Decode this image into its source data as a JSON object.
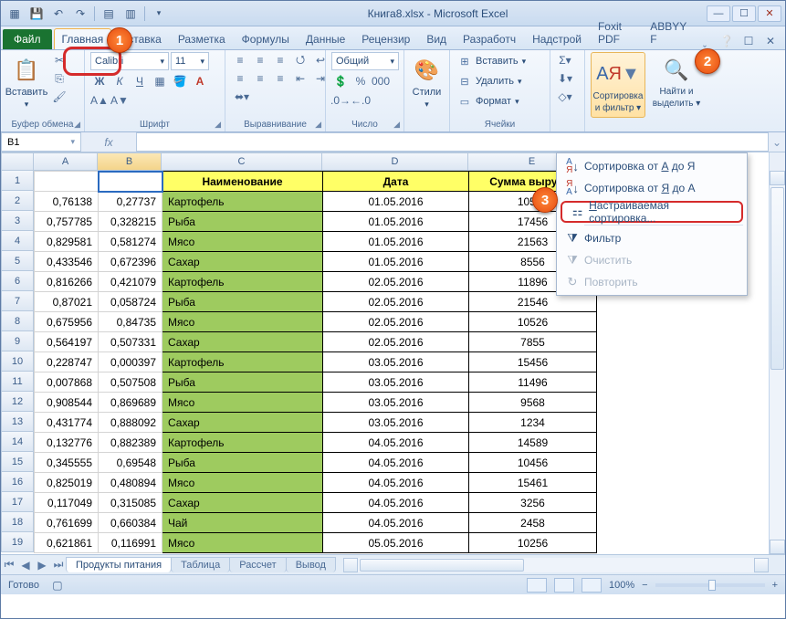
{
  "window": {
    "title": "Книга8.xlsx - Microsoft Excel"
  },
  "tabs": {
    "file": "Файл",
    "items": [
      "Главная",
      "Вставка",
      "Разметка",
      "Формулы",
      "Данные",
      "Рецензир",
      "Вид",
      "Разработч",
      "Надстрой",
      "Foxit PDF",
      "ABBYY F"
    ],
    "active": 0
  },
  "ribbon": {
    "clipboard": {
      "paste": "Вставить",
      "label": "Буфер обмена"
    },
    "font": {
      "name": "Calibri",
      "size": "11",
      "label": "Шрифт"
    },
    "align": {
      "label": "Выравнивание"
    },
    "number": {
      "format": "Общий",
      "label": "Число"
    },
    "styles": {
      "btn": "Стили"
    },
    "cells": {
      "insert": "Вставить",
      "delete": "Удалить",
      "format": "Формат",
      "label": "Ячейки"
    },
    "editing": {
      "sortfilter_l1": "Сортировка",
      "sortfilter_l2": "и фильтр",
      "find_l1": "Найти и",
      "find_l2": "выделить"
    }
  },
  "namebox": "B1",
  "columns": [
    "A",
    "B",
    "C",
    "D",
    "E"
  ],
  "headers": {
    "c": "Наименование",
    "d": "Дата",
    "e": "Сумма выручки"
  },
  "rows": [
    {
      "n": 1,
      "a": "",
      "b": "",
      "c": "hdr",
      "d": "hdr",
      "e": "hdr"
    },
    {
      "n": 2,
      "a": "0,76138",
      "b": "0,27737",
      "c": "Картофель",
      "d": "01.05.2016",
      "e": "10526"
    },
    {
      "n": 3,
      "a": "0,757785",
      "b": "0,328215",
      "c": "Рыба",
      "d": "01.05.2016",
      "e": "17456"
    },
    {
      "n": 4,
      "a": "0,829581",
      "b": "0,581274",
      "c": "Мясо",
      "d": "01.05.2016",
      "e": "21563"
    },
    {
      "n": 5,
      "a": "0,433546",
      "b": "0,672396",
      "c": "Сахар",
      "d": "01.05.2016",
      "e": "8556"
    },
    {
      "n": 6,
      "a": "0,816266",
      "b": "0,421079",
      "c": "Картофель",
      "d": "02.05.2016",
      "e": "11896"
    },
    {
      "n": 7,
      "a": "0,87021",
      "b": "0,058724",
      "c": "Рыба",
      "d": "02.05.2016",
      "e": "21546"
    },
    {
      "n": 8,
      "a": "0,675956",
      "b": "0,84735",
      "c": "Мясо",
      "d": "02.05.2016",
      "e": "10526"
    },
    {
      "n": 9,
      "a": "0,564197",
      "b": "0,507331",
      "c": "Сахар",
      "d": "02.05.2016",
      "e": "7855"
    },
    {
      "n": 10,
      "a": "0,228747",
      "b": "0,000397",
      "c": "Картофель",
      "d": "03.05.2016",
      "e": "15456"
    },
    {
      "n": 11,
      "a": "0,007868",
      "b": "0,507508",
      "c": "Рыба",
      "d": "03.05.2016",
      "e": "11496"
    },
    {
      "n": 12,
      "a": "0,908544",
      "b": "0,869689",
      "c": "Мясо",
      "d": "03.05.2016",
      "e": "9568"
    },
    {
      "n": 13,
      "a": "0,431774",
      "b": "0,888092",
      "c": "Сахар",
      "d": "03.05.2016",
      "e": "1234"
    },
    {
      "n": 14,
      "a": "0,132776",
      "b": "0,882389",
      "c": "Картофель",
      "d": "04.05.2016",
      "e": "14589"
    },
    {
      "n": 15,
      "a": "0,345555",
      "b": "0,69548",
      "c": "Рыба",
      "d": "04.05.2016",
      "e": "10456"
    },
    {
      "n": 16,
      "a": "0,825019",
      "b": "0,480894",
      "c": "Мясо",
      "d": "04.05.2016",
      "e": "15461"
    },
    {
      "n": 17,
      "a": "0,117049",
      "b": "0,315085",
      "c": "Сахар",
      "d": "04.05.2016",
      "e": "3256"
    },
    {
      "n": 18,
      "a": "0,761699",
      "b": "0,660384",
      "c": "Чай",
      "d": "04.05.2016",
      "e": "2458"
    },
    {
      "n": 19,
      "a": "0,621861",
      "b": "0,116991",
      "c": "Мясо",
      "d": "05.05.2016",
      "e": "10256"
    }
  ],
  "sheets": [
    "Продукты питания",
    "Таблица",
    "Рассчет",
    "Вывод"
  ],
  "status": {
    "ready": "Готово",
    "zoom": "100%"
  },
  "dropdown": {
    "sort_asc": "Сортировка от А до Я",
    "sort_desc": "Сортировка от Я до А",
    "custom": "Настраиваемая сортировка...",
    "filter": "Фильтр",
    "clear": "Очистить",
    "reapply": "Повторить"
  },
  "badges": {
    "b1": "1",
    "b2": "2",
    "b3": "3"
  }
}
